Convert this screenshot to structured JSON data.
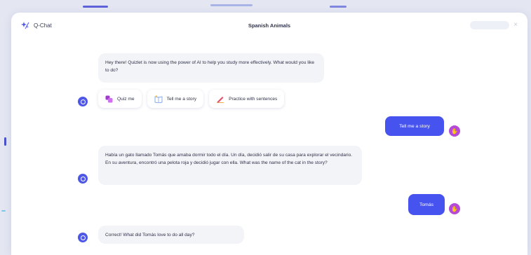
{
  "app": {
    "name": "Q-Chat"
  },
  "window": {
    "title": "Spanish Animals"
  },
  "colors": {
    "accent": "#4753ee",
    "bot_avatar": "#4f57e6",
    "user_avatar": "#b54ad6",
    "bot_bubble": "#f3f4f8",
    "background": "#e4e6f2"
  },
  "icons": {
    "brand": "sparkle-icon",
    "bot_avatar": "q-logo-icon",
    "user_avatar": "hand-icon",
    "quiz": "quiz-icon",
    "story": "book-icon",
    "practice": "pencil-icon",
    "close": "close-icon"
  },
  "messages": [
    {
      "role": "bot",
      "text": "Hey there! Quizlet is now using the power of AI to help you study more effectively. What would you like to do?"
    },
    {
      "role": "user",
      "text": "Tell me a story"
    },
    {
      "role": "bot",
      "text": "Había un gato llamado Tomás que amaba dormir todo el día. Un día, decidió salir de su casa para explorar el vecindario. En su aventura, encontró una pelota roja y decidió jugar con ella. What was the name of the cat in the story?"
    },
    {
      "role": "user",
      "text": "Tomás"
    },
    {
      "role": "bot",
      "text": "Correct! What did Tomás love to do all day?"
    }
  ],
  "options": [
    {
      "label": "Quiz me"
    },
    {
      "label": "Tell me a story"
    },
    {
      "label": "Practice with sentences"
    }
  ]
}
